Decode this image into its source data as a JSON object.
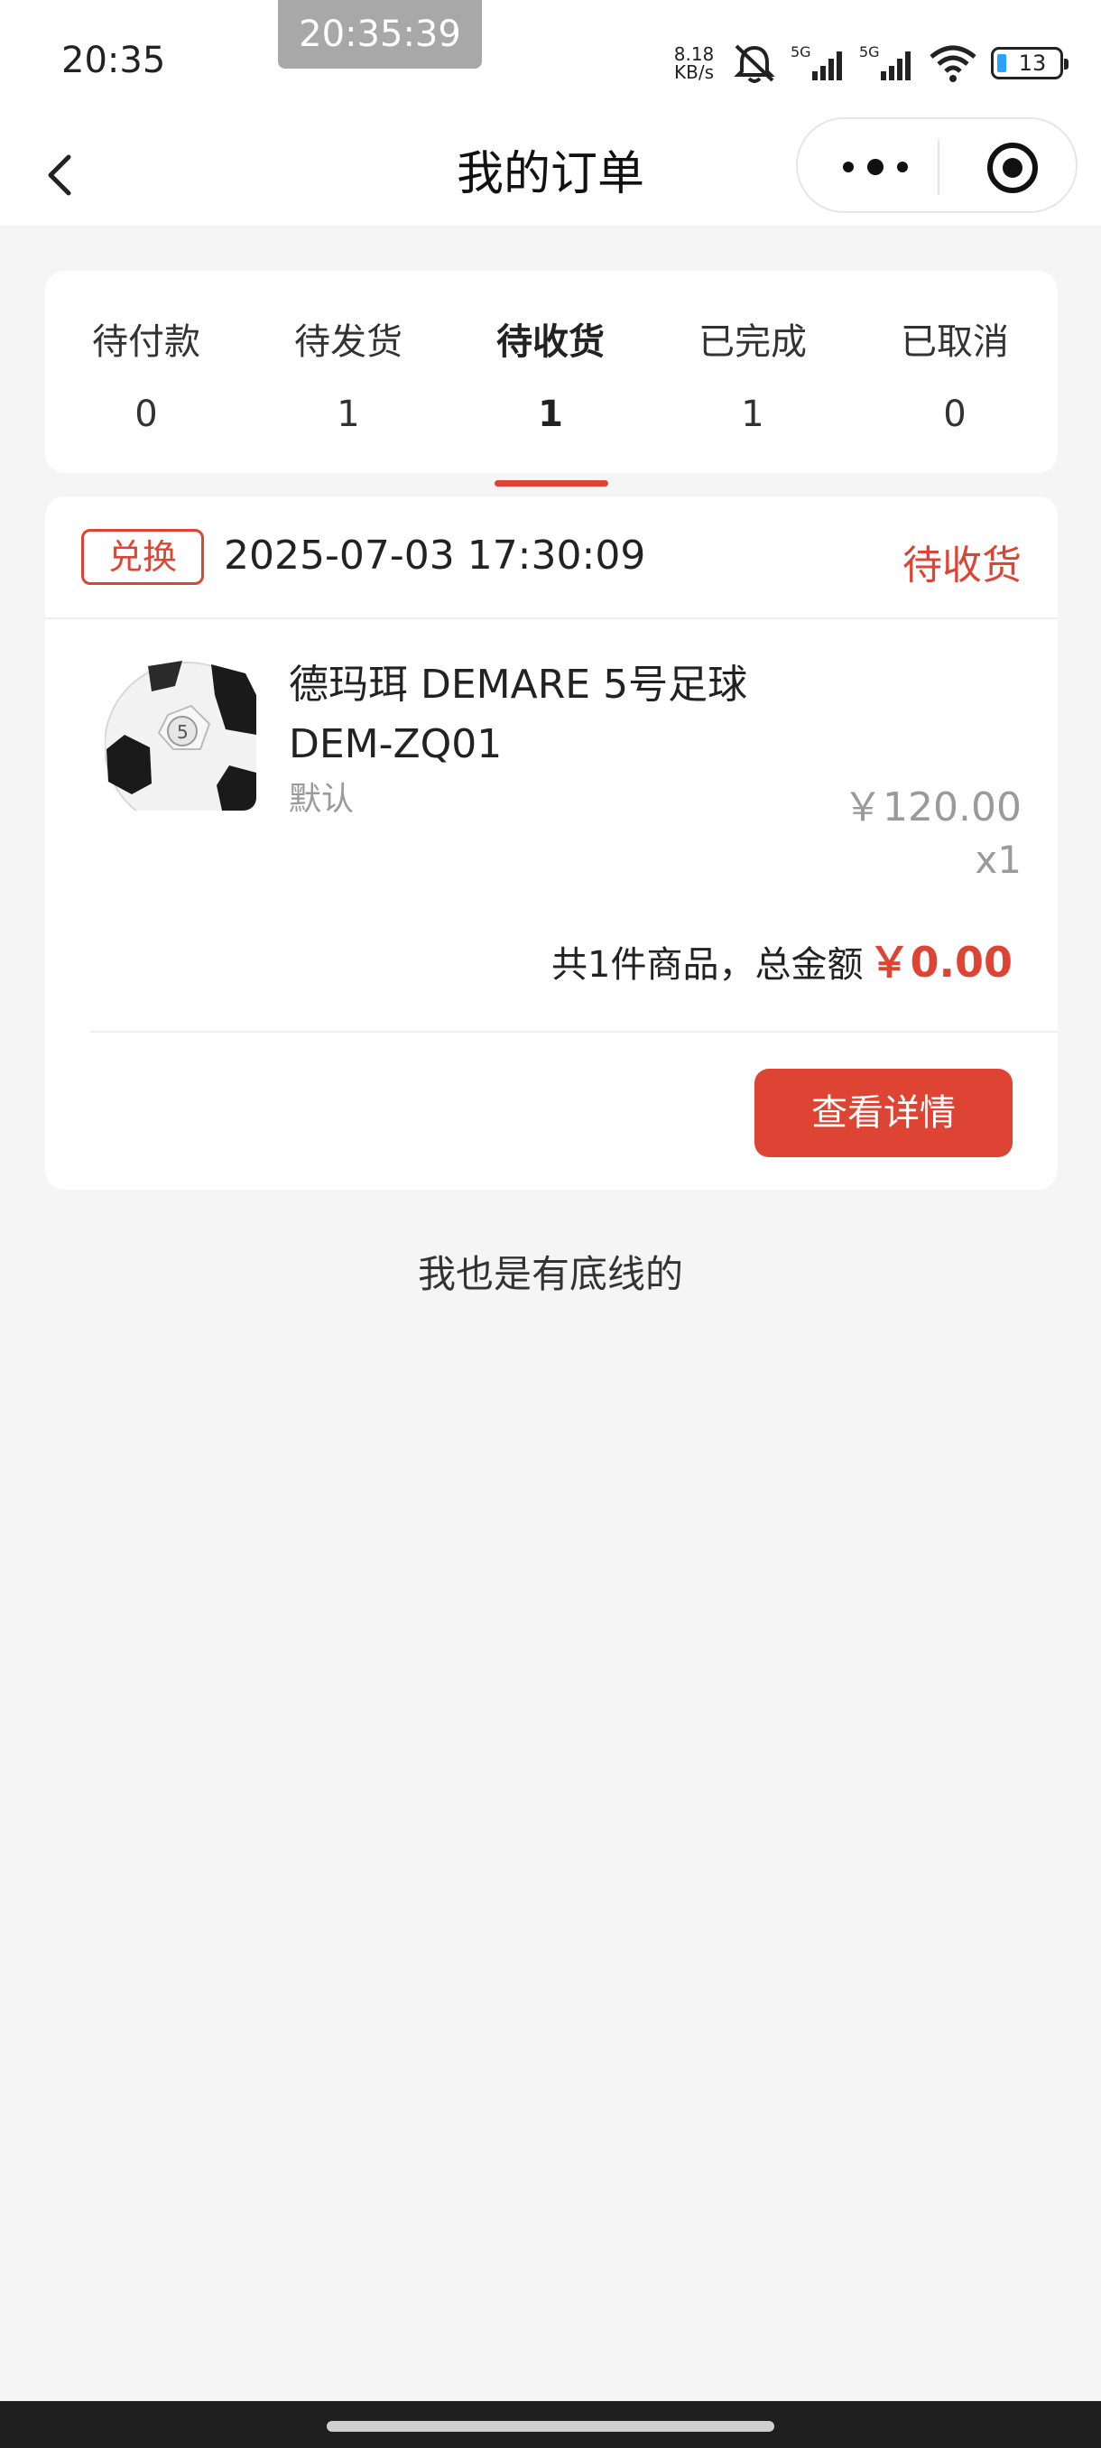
{
  "status_bar": {
    "time": "20:35",
    "overlay_time": "20:35:39",
    "net_speed_value": "8.18",
    "net_speed_unit": "KB/s",
    "signal1_label": "5G",
    "signal2_label": "5G",
    "battery_level": "13",
    "icons": [
      "mute-bell-icon",
      "signal-5g-icon",
      "signal-5g-icon",
      "wifi-icon",
      "battery-icon"
    ]
  },
  "navbar": {
    "title": "我的订单",
    "back_icon": "chevron-left-icon",
    "more_icon": "more-dots-icon",
    "target_icon": "target-icon"
  },
  "tabs": [
    {
      "label": "待付款",
      "count": "0",
      "active": false
    },
    {
      "label": "待发货",
      "count": "1",
      "active": false
    },
    {
      "label": "待收货",
      "count": "1",
      "active": true
    },
    {
      "label": "已完成",
      "count": "1",
      "active": false
    },
    {
      "label": "已取消",
      "count": "0",
      "active": false
    }
  ],
  "order": {
    "tag": "兑换",
    "datetime": "2025-07-03 17:30:09",
    "status": "待收货",
    "product": {
      "name": "德玛珥 DEMARE 5号足球 DEM-ZQ01",
      "spec": "默认",
      "price": "￥120.00",
      "qty": "x1"
    },
    "total_prefix": "共1件商品，总金额",
    "total_amount": "￥0.00",
    "detail_button": "查看详情"
  },
  "footer_note": "我也是有底线的",
  "colors": {
    "accent": "#dd4433",
    "background": "#f5f5f5",
    "card": "#ffffff",
    "muted_text": "#9a9a9a"
  }
}
